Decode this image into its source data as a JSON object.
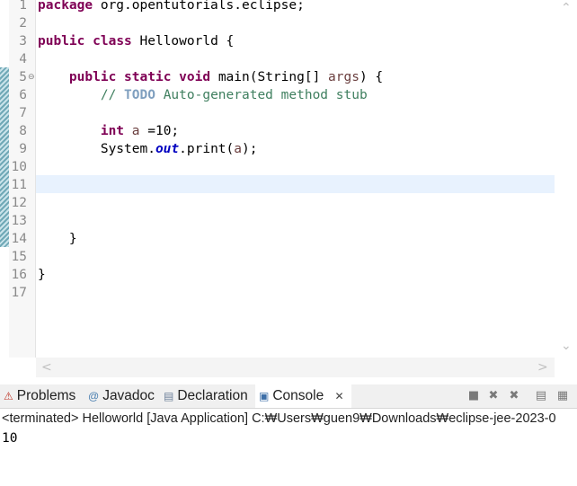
{
  "editor": {
    "line_numbers": [
      "1",
      "2",
      "3",
      "4",
      "5",
      "6",
      "7",
      "8",
      "9",
      "10",
      "11",
      "12",
      "13",
      "14",
      "15",
      "16",
      "17"
    ],
    "fold_marker": "⊖",
    "code": {
      "l1_kw": "package",
      "l1_rest": " org.opentutorials.eclipse;",
      "l3_kw1": "public",
      "l3_sp": " ",
      "l3_kw2": "class",
      "l3_rest": " Helloworld {",
      "l5_indent": "    ",
      "l5_kw1": "public",
      "l5_kw2": "static",
      "l5_kw3": "void",
      "l5_rest1": " main(String[] ",
      "l5_arg": "args",
      "l5_rest2": ") {",
      "l6_indent": "        ",
      "l6_comment": "// ",
      "l6_todo": "TODO",
      "l6_comment2": " Auto-generated method stub",
      "l8_indent": "        ",
      "l8_kw": "int",
      "l8_sp": " ",
      "l8_var": "a",
      "l8_rest": " =10;",
      "l9_indent": "        ",
      "l9_a": "System.",
      "l9_field": "out",
      "l9_b": ".print(",
      "l9_var": "a",
      "l9_c": ");",
      "l14": "    }",
      "l16": "}"
    }
  },
  "scroll": {
    "up": "⌃",
    "down": "⌄",
    "left": "<",
    "right": ">"
  },
  "tabs": [
    {
      "label": "Problems",
      "icon": "⚠"
    },
    {
      "label": "Javadoc",
      "icon": "@"
    },
    {
      "label": "Declaration",
      "icon": "▤"
    },
    {
      "label": "Console",
      "icon": "▣",
      "close": "✕"
    }
  ],
  "toolbar": {
    "terminate": "■",
    "remove": "✖",
    "remove_all": "✖",
    "pin": "▤",
    "display": "▦"
  },
  "console": {
    "status": "<terminated> Helloworld [Java Application] C:₩Users₩guen9₩Downloads₩eclipse-jee-2023-0",
    "output": "10"
  }
}
